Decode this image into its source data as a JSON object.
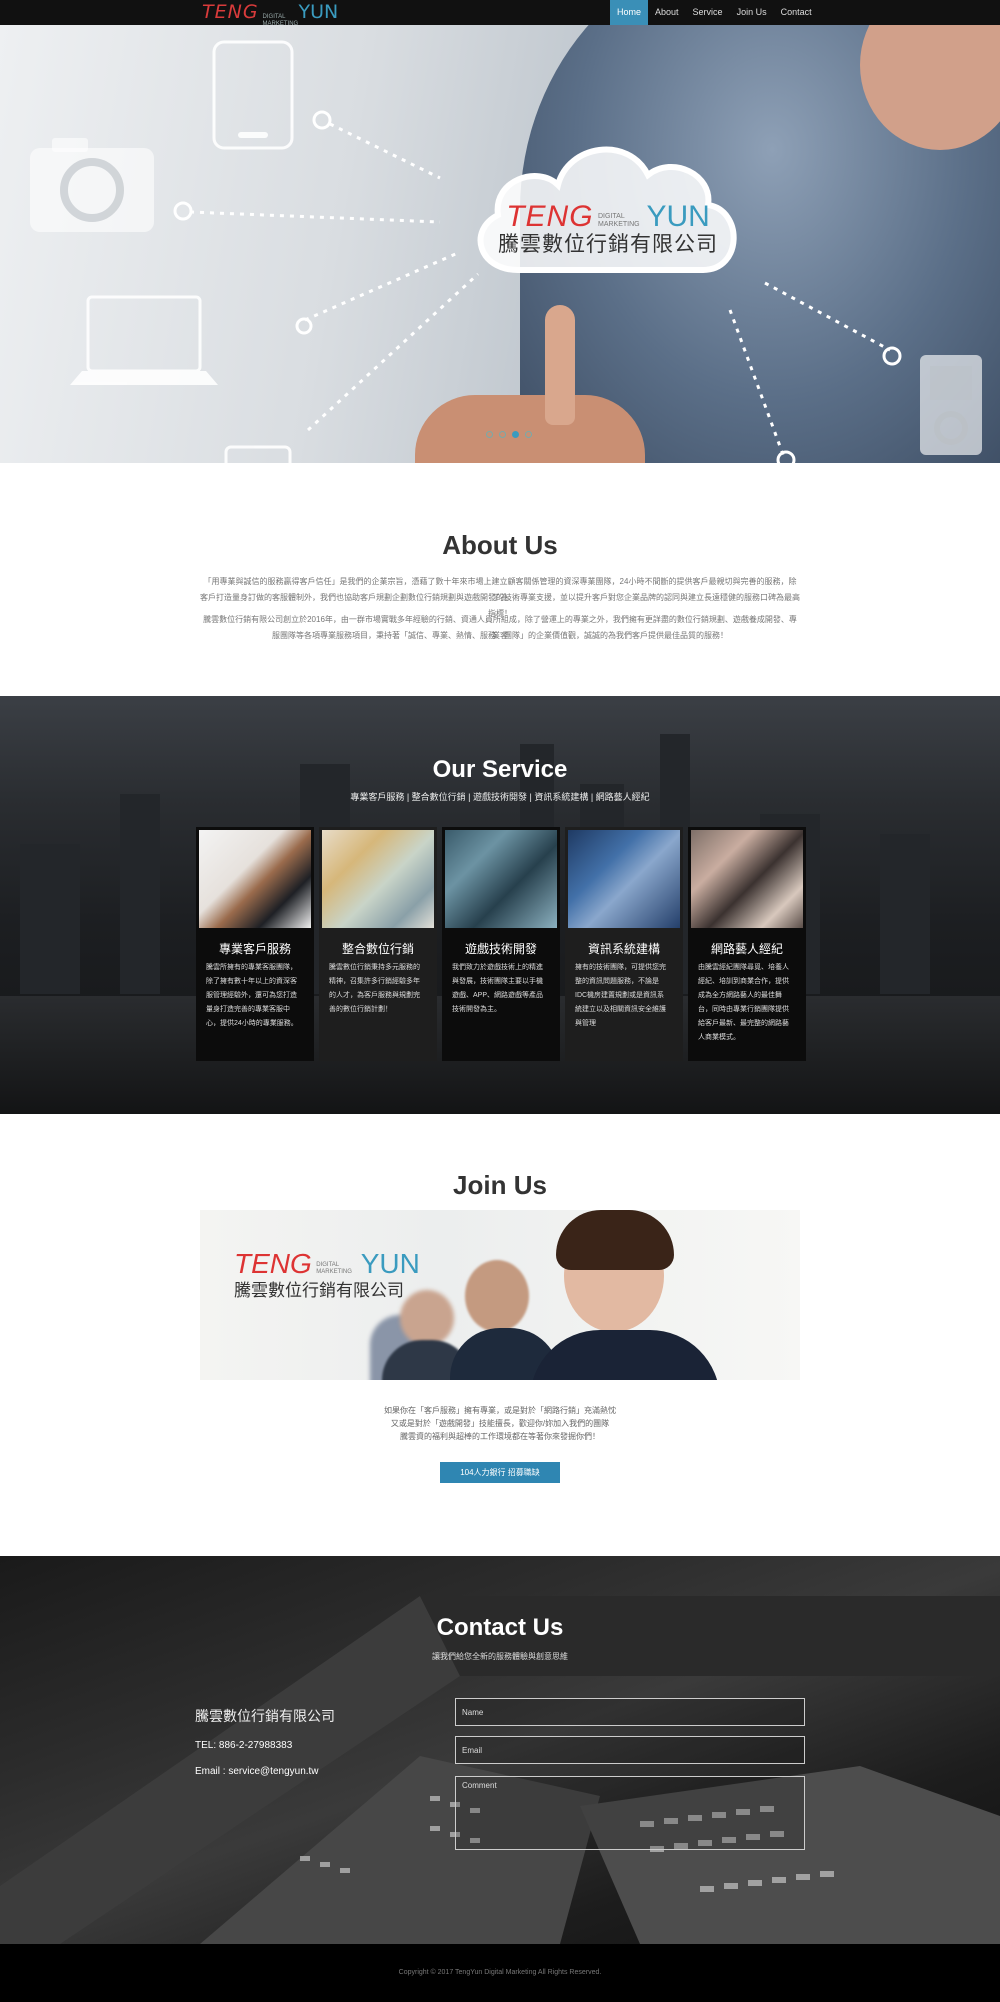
{
  "nav": {
    "logo": {
      "teng": "TENG",
      "tagline": "DIGITAL MARKETING",
      "yun": "YUN"
    },
    "items": [
      "Home",
      "About",
      "Service",
      "Join Us",
      "Contact"
    ],
    "active": "Home"
  },
  "hero": {
    "logo": {
      "teng": "TENG",
      "tagline": "DIGITAL MARKETING",
      "yun": "YUN",
      "company": "騰雲數位行銷有限公司"
    }
  },
  "about": {
    "title": "About Us",
    "paragraphs": [
      "「用專業與誠信的服務贏得客戶信任」是我們的企業宗旨，憑藉了數十年來市場上建立顧客關係管理的資深專業團隊，24小時不間斷的提供客戶最親切與完善的服務，除了為",
      "客戶打造量身訂做的客服體制外，我們也協助客戶規劃企劃數位行銷規劃與遊戲開發的技術專業支援，並以提升客戶對您企業品牌的認同與建立長遠穩健的服務口碑為最高指標！",
      "騰雲數位行銷有限公司創立於2016年，由一群市場實戰多年經驗的行銷、資通人員所組成，除了營運上的專業之外，我們擁有更詳盡的數位行銷規劃、遊戲養成開發、專業客",
      "服團隊等各項專業服務項目，秉持著「誠信、專業、熱情、服務、團隊」的企業價值觀，誠誠的為我們客戶提供最佳品質的服務！"
    ]
  },
  "service": {
    "title": "Our Service",
    "subtitle": "專業客戶服務 | 整合數位行銷 | 遊戲技術開發 | 資訊系統建構 | 網路藝人經紀",
    "cards": [
      {
        "title": "專業客戶服務",
        "text": "騰雲所擁有的專業客服團隊，除了擁有數十年以上的資深客服管理經驗外，還可為您打造量身打造完善的專業客服中心，提供24小時的專業服務。"
      },
      {
        "title": "整合數位行銷",
        "text": "騰雲數位行銷秉持多元服務的精神，召集許多行銷經驗多年的人才，為客戶服務與規劃完善的數位行銷計劃！"
      },
      {
        "title": "遊戲技術開發",
        "text": "我們致力於遊戲技術上的精進與發展，技術團隊主要以手機遊戲、APP、網路遊戲等產品技術開發為主。"
      },
      {
        "title": "資訊系統建構",
        "text": "擁有的技術團隊，可提供您完整的資訊問題服務，不論是IDC機房建置規劃或是資訊系統建立以及相關資訊安全維護與管理"
      },
      {
        "title": "網路藝人經紀",
        "text": "由騰雲經紀團隊尋覓、培養人經紀、培訓到商業合作，提供成為全方網路藝人的最佳舞台，同時由專業行銷團隊提供給客戶最新、最完整的網路藝人商業模式。"
      }
    ]
  },
  "join": {
    "title": "Join Us",
    "banner_logo": {
      "teng": "TENG",
      "tagline": "DIGITAL MARKETING",
      "yun": "YUN",
      "company": "騰雲數位行銷有限公司"
    },
    "lines": [
      "如果你在「客戶服務」擁有專業，或是對於「網路行銷」充滿熱忱",
      "又或是對於「遊戲開發」技能擅長，歡迎你/妳加入我們的團隊",
      "騰雲資的福利與超棒的工作環境都在等著你來發掘你們！"
    ],
    "button": "104人力銀行 招募職缺"
  },
  "contact": {
    "title": "Contact Us",
    "subtitle": "讓我們給您全新的服務體驗與創意思維",
    "company": "騰雲數位行銷有限公司",
    "tel": "TEL: 886-2-27988383",
    "email": "Email : service@tengyun.tw",
    "placeholders": {
      "name": "Name",
      "email": "Email",
      "comment": "Comment"
    }
  },
  "footer": {
    "copyright": "Copyright © 2017 TengYun Digital Marketing All Rights Reserved."
  },
  "colors": {
    "accent": "#3a8fb7",
    "brand_red": "#d93b3b",
    "brand_blue": "#3a9bbf"
  }
}
